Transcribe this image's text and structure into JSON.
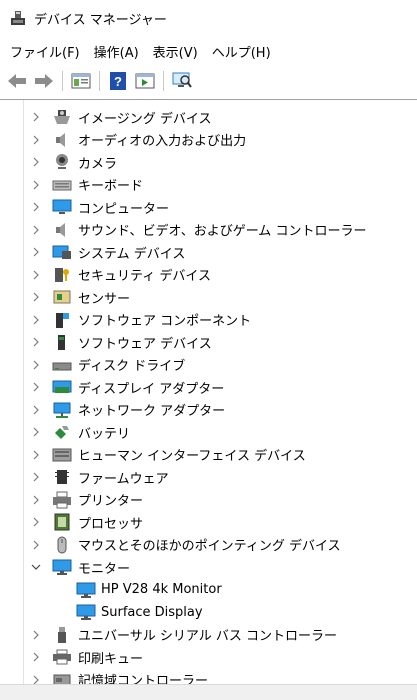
{
  "window": {
    "title": "デバイス マネージャー"
  },
  "menu": [
    "ファイル(F)",
    "操作(A)",
    "表示(V)",
    "ヘルプ(H)"
  ],
  "toolbar": {
    "buttons": [
      "back-icon",
      "forward-icon",
      "properties-icon",
      "help-icon",
      "run-icon",
      "scan-hardware-icon"
    ]
  },
  "tree": {
    "items": [
      {
        "label": "イメージング デバイス",
        "icon": "camera-imaging-icon",
        "expanded": false
      },
      {
        "label": "オーディオの入力および出力",
        "icon": "speaker-icon",
        "expanded": false
      },
      {
        "label": "カメラ",
        "icon": "webcam-icon",
        "expanded": false
      },
      {
        "label": "キーボード",
        "icon": "keyboard-icon",
        "expanded": false
      },
      {
        "label": "コンピューター",
        "icon": "computer-icon",
        "expanded": false
      },
      {
        "label": "サウンド、ビデオ、およびゲーム コントローラー",
        "icon": "speaker-icon",
        "expanded": false
      },
      {
        "label": "システム デバイス",
        "icon": "system-devices-icon",
        "expanded": false
      },
      {
        "label": "セキュリティ デバイス",
        "icon": "security-key-icon",
        "expanded": false
      },
      {
        "label": "センサー",
        "icon": "sensor-icon",
        "expanded": false
      },
      {
        "label": "ソフトウェア コンポーネント",
        "icon": "software-component-icon",
        "expanded": false
      },
      {
        "label": "ソフトウェア デバイス",
        "icon": "software-device-icon",
        "expanded": false
      },
      {
        "label": "ディスク ドライブ",
        "icon": "disk-drive-icon",
        "expanded": false
      },
      {
        "label": "ディスプレイ アダプター",
        "icon": "display-adapter-icon",
        "expanded": false
      },
      {
        "label": "ネットワーク アダプター",
        "icon": "network-adapter-icon",
        "expanded": false
      },
      {
        "label": "バッテリ",
        "icon": "battery-icon",
        "expanded": false
      },
      {
        "label": "ヒューマン インターフェイス デバイス",
        "icon": "hid-icon",
        "expanded": false
      },
      {
        "label": "ファームウェア",
        "icon": "firmware-chip-icon",
        "expanded": false
      },
      {
        "label": "プリンター",
        "icon": "printer-icon",
        "expanded": false
      },
      {
        "label": "プロセッサ",
        "icon": "processor-icon",
        "expanded": false
      },
      {
        "label": "マウスとそのほかのポインティング デバイス",
        "icon": "mouse-icon",
        "expanded": false
      },
      {
        "label": "モニター",
        "icon": "monitor-icon",
        "expanded": true,
        "children": [
          {
            "label": "HP V28 4k Monitor",
            "icon": "monitor-icon"
          },
          {
            "label": "Surface Display",
            "icon": "monitor-icon"
          }
        ]
      },
      {
        "label": "ユニバーサル シリアル バス コントローラー",
        "icon": "usb-icon",
        "expanded": false
      },
      {
        "label": "印刷キュー",
        "icon": "print-queue-icon",
        "expanded": false
      },
      {
        "label": "記憶域コントローラー",
        "icon": "storage-controller-icon",
        "expanded": false
      }
    ]
  },
  "colors": {
    "accent_blue": "#1e88e5",
    "monitor_blue": "#2f9be8",
    "toolbar_icon_gray": "#7a7a7a"
  }
}
